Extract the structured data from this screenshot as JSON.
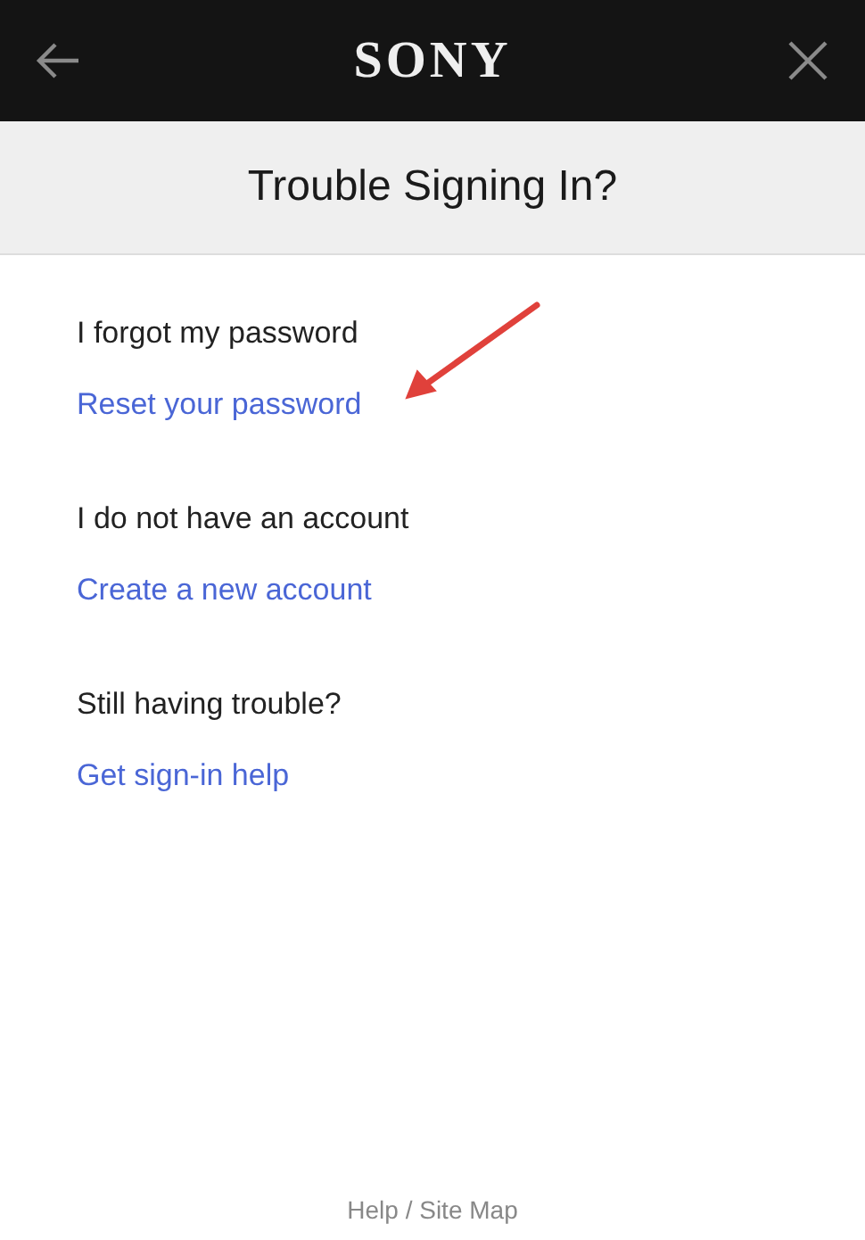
{
  "header": {
    "logo": "SONY"
  },
  "title": "Trouble Signing In?",
  "sections": [
    {
      "label": "I forgot my password",
      "link": "Reset your password"
    },
    {
      "label": "I do not have an account",
      "link": "Create a new account"
    },
    {
      "label": "Still having trouble?",
      "link": "Get sign-in help"
    }
  ],
  "footer": "Help / Site Map"
}
